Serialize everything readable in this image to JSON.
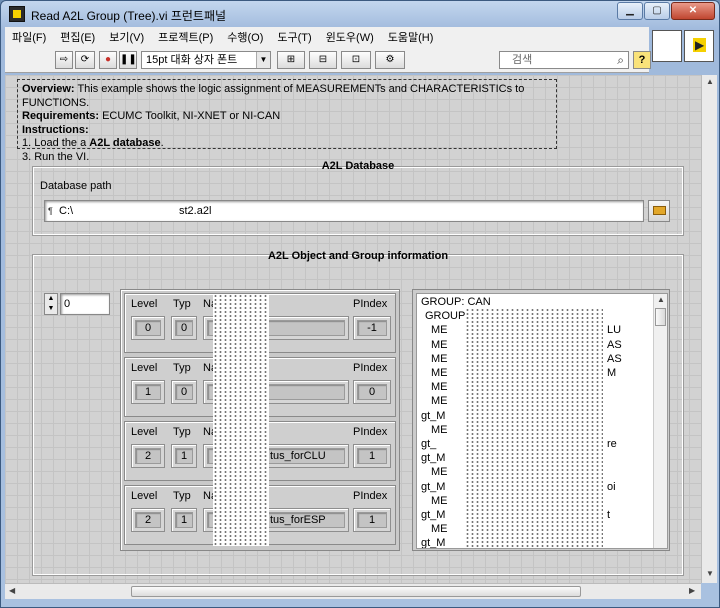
{
  "window": {
    "title": "Read A2L Group (Tree).vi 프런트패널",
    "buttons": {
      "minimize": "▁",
      "maximize": "▢",
      "close": "✕"
    }
  },
  "menu": [
    "파일(F)",
    "편집(E)",
    "보기(V)",
    "프로젝트(P)",
    "수행(O)",
    "도구(T)",
    "윈도우(W)",
    "도움말(H)"
  ],
  "toolbar": {
    "run": "⇨",
    "run_continuous": "⟳",
    "abort": "●",
    "pause": "❚❚",
    "font": "15pt 대화 상자 폰트",
    "align": "⊞",
    "distribute": "⊟",
    "resize": "⊡",
    "reorder": "⚙",
    "search_placeholder": "검색",
    "help": "?"
  },
  "note": {
    "overview_label": "Overview:",
    "overview_text": " This example shows the logic assignment of MEASUREMENTs and CHARACTERISTICs to FUNCTIONS.",
    "requirements_label": "Requirements:",
    "requirements_text": " ECUMC Toolkit, NI-XNET or NI-CAN",
    "instructions_label": "Instructions:",
    "step1_pre": "1. Load the a ",
    "step1_bold": "A2L database",
    "step1_post": ".",
    "step3": "3. Run the VI."
  },
  "database": {
    "title": "A2L Database",
    "path_label": "Database path",
    "path_value_left": "C:\\",
    "path_value_right": "st2.a2l"
  },
  "info": {
    "title": "A2L Object and Group information",
    "index": "0",
    "headers": {
      "level": "Level",
      "typ": "Typ",
      "name": "Name",
      "pindex": "PIndex"
    },
    "rows": [
      {
        "level": "0",
        "typ": "0",
        "name": "",
        "pindex": "-1"
      },
      {
        "level": "1",
        "typ": "0",
        "name": "",
        "pindex": "0"
      },
      {
        "level": "2",
        "typ": "1",
        "name": "tus_forCLU",
        "pindex": "1"
      },
      {
        "level": "2",
        "typ": "1",
        "name": "tus_forESP",
        "pindex": "1"
      }
    ],
    "tree": [
      "GROUP: CAN",
      "GROUP:",
      "ME",
      "ME",
      "ME",
      "ME",
      "ME",
      "ME",
      "gt_M",
      "ME",
      "gt_",
      "gt_M",
      "ME",
      "gt_M",
      "ME",
      "gt_M",
      "ME",
      "gt_M"
    ],
    "tree_right": [
      {
        "line": 2,
        "text": "LU"
      },
      {
        "line": 3,
        "text": "AS"
      },
      {
        "line": 4,
        "text": "AS"
      },
      {
        "line": 5,
        "text": "M"
      },
      {
        "line": 10,
        "text": "re"
      },
      {
        "line": 13,
        "text": "oi"
      },
      {
        "line": 15,
        "text": "t"
      }
    ]
  }
}
